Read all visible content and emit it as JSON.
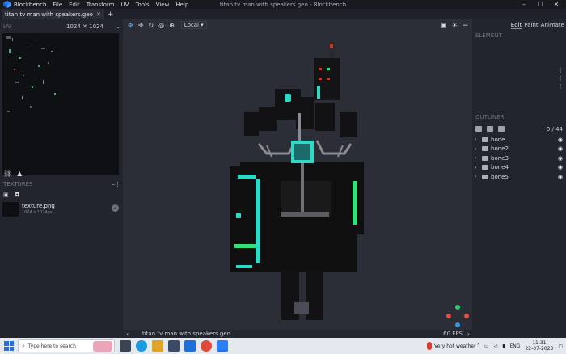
{
  "app": {
    "name": "Blockbench",
    "menu": [
      "File",
      "Edit",
      "Transform",
      "UV",
      "Tools",
      "View",
      "Help"
    ],
    "window_title": "titan tv man with speakers.geo - Blockbench"
  },
  "tabs": [
    {
      "label": "titan tv man with speakers.geo"
    }
  ],
  "uv_panel": {
    "title": "UV",
    "resolution": "1024 ✕ 1024"
  },
  "textures_panel": {
    "title": "TEXTURES",
    "item": {
      "name": "texture.png",
      "size": "1024 x 1024px"
    }
  },
  "viewport": {
    "space_selector": "Local",
    "status_filename": "titan tv man with speakers.geo",
    "fps": "60 FPS"
  },
  "modes": [
    "Edit",
    "Paint",
    "Animate"
  ],
  "element_panel": {
    "title": "ELEMENT"
  },
  "outliner": {
    "title": "OUTLINER",
    "count": "0 / 44",
    "bones": [
      "bone",
      "bone2",
      "bone3",
      "bone4",
      "bone5"
    ]
  },
  "taskbar": {
    "search_placeholder": "Type here to search",
    "weather": "Very hot weather",
    "lang": "ENG",
    "time": "11:31",
    "date": "22-07-2023"
  },
  "colors": {
    "accent": "#41a7ff",
    "model_glow": "#2fd9c4",
    "model_green": "#34e07a"
  }
}
